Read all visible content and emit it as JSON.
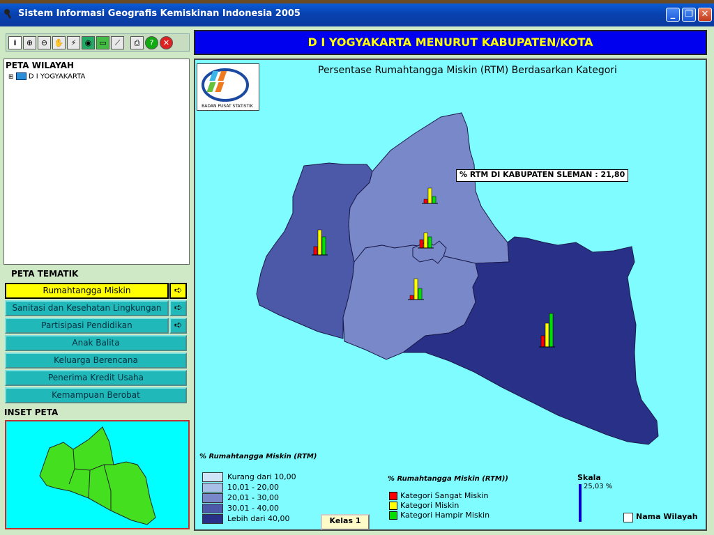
{
  "window": {
    "title": "Sistem Informasi Geografis Kemiskinan Indonesia 2005",
    "controls": [
      "minimize",
      "restore",
      "close"
    ]
  },
  "toolbar": {
    "tools": [
      "info-icon",
      "zoom-in-icon",
      "zoom-out-icon",
      "pan-hand-icon",
      "pencil-icon",
      "globe-icon",
      "label-icon",
      "ruler-icon",
      "print-icon",
      "help-icon",
      "exit-icon"
    ]
  },
  "tree": {
    "title": "PETA WILAYAH",
    "root_label": "D I YOGYAKARTA"
  },
  "tematik": {
    "title": "PETA TEMATIK",
    "items": [
      {
        "label": "Rumahtangga Miskin",
        "selected": true,
        "has_arrow": true
      },
      {
        "label": "Sanitasi dan Kesehatan Lingkungan",
        "selected": false,
        "has_arrow": true
      },
      {
        "label": "Partisipasi Pendidikan",
        "selected": false,
        "has_arrow": true
      },
      {
        "label": "Anak Balita",
        "selected": false,
        "has_arrow": false
      },
      {
        "label": "Keluarga Berencana",
        "selected": false,
        "has_arrow": false
      },
      {
        "label": "Penerima Kredit Usaha",
        "selected": false,
        "has_arrow": false
      },
      {
        "label": "Kemampuan Berobat",
        "selected": false,
        "has_arrow": false
      }
    ],
    "arrow_glyph": "➪"
  },
  "inset": {
    "title": "INSET PETA"
  },
  "header": {
    "banner": "D I YOGYAKARTA MENURUT KABUPATEN/KOTA"
  },
  "map": {
    "title": "Persentase Rumahtangga Miskin (RTM) Berdasarkan Kategori",
    "logo_caption": "BADAN PUSAT STATISTIK",
    "callout": "% RTM DI KABUPATEN SLEMAN : 21,80",
    "legend_title": "% Rumahtangga Miskin (RTM)",
    "legend": [
      {
        "label": "Kurang dari  10,00",
        "color": "#d0e4f8"
      },
      {
        "label": "10,01  -  20,00",
        "color": "#a8c0e8"
      },
      {
        "label": "20,01  -  30,00",
        "color": "#7888c8"
      },
      {
        "label": "30,01  -  40,00",
        "color": "#4c58a8"
      },
      {
        "label": "Lebih dari  40,00",
        "color": "#283088"
      }
    ],
    "kelas_button": "Kelas 1",
    "category_title": "% Rumahtangga Miskin (RTM))",
    "categories": [
      {
        "label": "Kategori Sangat Miskin",
        "color": "#ff0000"
      },
      {
        "label": "Kategori Miskin",
        "color": "#ffff00"
      },
      {
        "label": "Kategori Hampir Miskin",
        "color": "#00e000"
      }
    ],
    "skala_title": "Skala",
    "skala_value": "25,03 %",
    "nama_wilayah_label": "Nama Wilayah",
    "nama_wilayah_checked": false,
    "region_colors": {
      "kulon_progo": "#4c58a8",
      "sleman": "#7888c8",
      "bantul": "#7888c8",
      "yogyakarta": "#7888c8",
      "gunung_kidul": "#283088"
    },
    "inset_color": "#44e020",
    "inset_water": "#00ffff"
  }
}
